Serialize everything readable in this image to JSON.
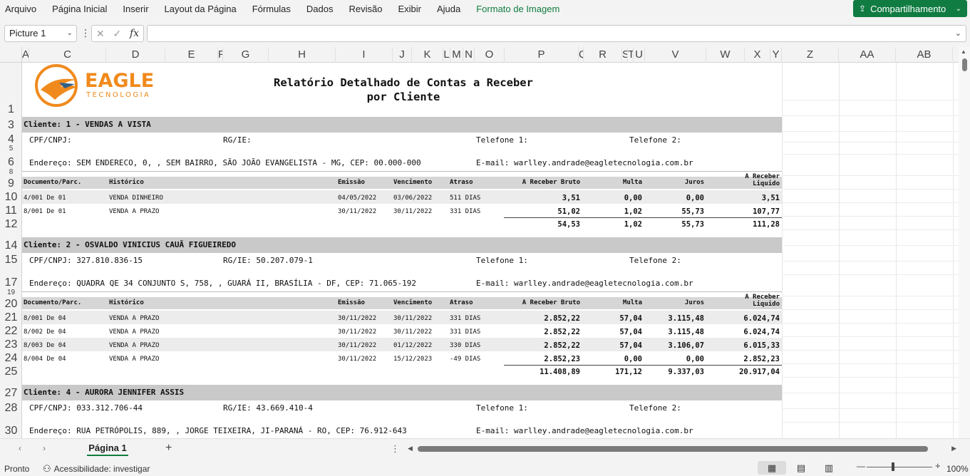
{
  "menu": {
    "items": [
      "Arquivo",
      "Página Inicial",
      "Inserir",
      "Layout da Página",
      "Fórmulas",
      "Dados",
      "Revisão",
      "Exibir",
      "Ajuda",
      "Formato de Imagem"
    ],
    "share_label": "Compartilhamento",
    "accent_color": "#107c41"
  },
  "formula_bar": {
    "name_box": "Picture 1",
    "fx_label": "fx",
    "value": ""
  },
  "columns": [
    "A",
    "C",
    "D",
    "E",
    "F",
    "G",
    "H",
    "I",
    "J",
    "K",
    "L",
    "M",
    "N",
    "O",
    "P",
    "Q",
    "R",
    "S",
    "T",
    "U",
    "V",
    "W",
    "X",
    "Y",
    "Z",
    "AA",
    "AB"
  ],
  "rows": [
    "1",
    "3",
    "4",
    "5",
    "6",
    "8",
    "9",
    "10",
    "11",
    "12",
    "14",
    "15",
    "17",
    "19",
    "20",
    "21",
    "22",
    "23",
    "24",
    "25",
    "27",
    "28",
    "30"
  ],
  "report": {
    "logo_word": "EAGLE",
    "logo_sub": "TECNOLOGIA",
    "title_line1": "Relatório Detalhado de Contas a Receber",
    "title_line2": "por Cliente",
    "headers": {
      "doc": "Documento/Parc.",
      "hist": "Histórico",
      "emissao": "Emissão",
      "venc": "Vencimento",
      "atraso": "Atraso",
      "bruto": "A Receber Bruto",
      "multa": "Multa",
      "juros": "Juros",
      "liquido_1": "A Receber",
      "liquido_2": "Liquido"
    },
    "clients": [
      {
        "title": "Cliente: 1 - VENDAS A VISTA",
        "cpf": "CPF/CNPJ:",
        "rg": "RG/IE:",
        "tel1": "Telefone 1:",
        "tel2": "Telefone 2:",
        "endereco": "Endereço: SEM ENDERECO, 0, , SEM BAIRRO, SÃO JOÃO EVANGELISTA - MG, CEP: 00.000-000",
        "email": "E-mail: warlley.andrade@eagletecnologia.com.br",
        "items": [
          {
            "doc": "4/001 De 01",
            "hist": "VENDA DINHEIRO",
            "emissao": "04/05/2022",
            "venc": "03/06/2022",
            "atraso": "511 DIAS",
            "bruto": "3,51",
            "multa": "0,00",
            "juros": "0,00",
            "liquido": "3,51"
          },
          {
            "doc": "8/001 De 01",
            "hist": "VENDA A PRAZO",
            "emissao": "30/11/2022",
            "venc": "30/11/2022",
            "atraso": "331 DIAS",
            "bruto": "51,02",
            "multa": "1,02",
            "juros": "55,73",
            "liquido": "107,77"
          }
        ],
        "total": {
          "bruto": "54,53",
          "multa": "1,02",
          "juros": "55,73",
          "liquido": "111,28"
        }
      },
      {
        "title": "Cliente: 2 - OSVALDO VINICIUS CAUÃ FIGUEIREDO",
        "cpf": "CPF/CNPJ: 327.810.836-15",
        "rg": "RG/IE: 50.207.079-1",
        "tel1": "Telefone 1:",
        "tel2": "Telefone 2:",
        "endereco": "Endereço: QUADRA QE 34 CONJUNTO S, 758, , GUARÁ II, BRASÍLIA - DF, CEP: 71.065-192",
        "email": "E-mail: warlley.andrade@eagletecnologia.com.br",
        "items": [
          {
            "doc": "8/001 De 04",
            "hist": "VENDA A PRAZO",
            "emissao": "30/11/2022",
            "venc": "30/11/2022",
            "atraso": "331 DIAS",
            "bruto": "2.852,22",
            "multa": "57,04",
            "juros": "3.115,48",
            "liquido": "6.024,74"
          },
          {
            "doc": "8/002 De 04",
            "hist": "VENDA A PRAZO",
            "emissao": "30/11/2022",
            "venc": "30/11/2022",
            "atraso": "331 DIAS",
            "bruto": "2.852,22",
            "multa": "57,04",
            "juros": "3.115,48",
            "liquido": "6.024,74"
          },
          {
            "doc": "8/003 De 04",
            "hist": "VENDA A PRAZO",
            "emissao": "30/11/2022",
            "venc": "01/12/2022",
            "atraso": "330 DIAS",
            "bruto": "2.852,22",
            "multa": "57,04",
            "juros": "3.106,07",
            "liquido": "6.015,33"
          },
          {
            "doc": "8/004 De 04",
            "hist": "VENDA A PRAZO",
            "emissao": "30/11/2022",
            "venc": "15/12/2023",
            "atraso": "-49 DIAS",
            "bruto": "2.852,23",
            "multa": "0,00",
            "juros": "0,00",
            "liquido": "2.852,23"
          }
        ],
        "total": {
          "bruto": "11.408,89",
          "multa": "171,12",
          "juros": "9.337,03",
          "liquido": "20.917,04"
        }
      },
      {
        "title": "Cliente: 4 - AURORA JENNIFER ASSIS",
        "cpf": "CPF/CNPJ: 033.312.706-44",
        "rg": "RG/IE: 43.669.410-4",
        "tel1": "Telefone 1:",
        "tel2": "Telefone 2:",
        "endereco": "Endereço: RUA PETRÓPOLIS, 889, , JORGE TEIXEIRA, JI-PARANÁ - RO, CEP: 76.912-643",
        "email": "E-mail: warlley.andrade@eagletecnologia.com.br",
        "items": [],
        "total": null
      }
    ]
  },
  "sheet_tabs": {
    "active": "Página 1"
  },
  "status": {
    "ready": "Pronto",
    "accessibility": "Acessibilidade: investigar",
    "zoom": "100%"
  }
}
